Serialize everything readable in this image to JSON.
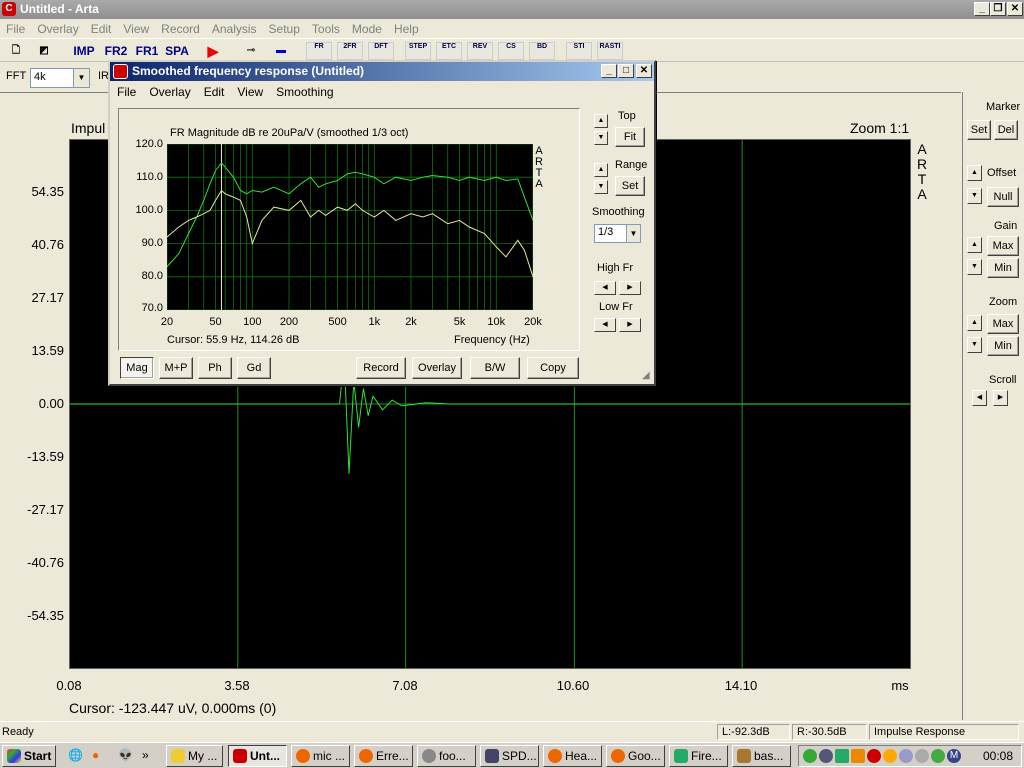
{
  "window": {
    "title": "Untitled - Arta",
    "menu": [
      "File",
      "Overlay",
      "Edit",
      "View",
      "Record",
      "Analysis",
      "Setup",
      "Tools",
      "Mode",
      "Help"
    ]
  },
  "toolbar": {
    "imp": "IMP",
    "fr2": "FR2",
    "fr1": "FR1",
    "spa": "SPA",
    "small_buttons": [
      "FR",
      "2FR",
      "DFT",
      "STEP",
      "ETC",
      "REV",
      "CS",
      "BD",
      "STI",
      "RASTI"
    ]
  },
  "toolbar2": {
    "fft_label": "FFT",
    "fft_value": "4k",
    "ir_label": "IR"
  },
  "impulse": {
    "title": "Impul",
    "zoom_label": "Zoom 1:1",
    "arta_vertical": [
      "A",
      "R",
      "T",
      "A"
    ],
    "y_ticks": [
      "54.35",
      "40.76",
      "27.17",
      "13.59",
      "0.00",
      "-13.59",
      "-27.17",
      "-40.76",
      "-54.35"
    ],
    "x_ticks": [
      "0.08",
      "3.58",
      "7.08",
      "10.60",
      "14.10"
    ],
    "x_unit": "ms",
    "cursor": "Cursor: -123.447 uV, 0.000ms (0)"
  },
  "right_panel": {
    "marker_label": "Marker",
    "marker_set": "Set",
    "marker_del": "Del",
    "offset_label": "Offset",
    "offset_null": "Null",
    "gain_label": "Gain",
    "gain_max": "Max",
    "gain_min": "Min",
    "zoom_label": "Zoom",
    "zoom_max": "Max",
    "zoom_min": "Min",
    "scroll_label": "Scroll"
  },
  "dialog": {
    "title": "Smoothed frequency response (Untitled)",
    "menu": [
      "File",
      "Overlay",
      "Edit",
      "View",
      "Smoothing"
    ],
    "top_label": "Top",
    "fit": "Fit",
    "range_label": "Range",
    "set": "Set",
    "smoothing_label": "Smoothing",
    "smoothing_value": "1/3",
    "high_fr_label": "High Fr",
    "low_fr_label": "Low Fr",
    "bottom_buttons": [
      "Mag",
      "M+P",
      "Ph",
      "Gd"
    ],
    "action_buttons": [
      "Record",
      "Overlay",
      "B/W",
      "Copy"
    ]
  },
  "chart_data": {
    "type": "line",
    "title": "FR Magnitude dB re 20uPa/V (smoothed 1/3 oct)",
    "xlabel": "Frequency (Hz)",
    "ylabel": "",
    "x_scale": "log",
    "xlim": [
      20,
      20000
    ],
    "ylim": [
      70,
      120
    ],
    "x_tick_labels": [
      "20",
      "50",
      "100",
      "200",
      "500",
      "1k",
      "2k",
      "5k",
      "10k",
      "20k"
    ],
    "y_tick_labels": [
      "120.0",
      "110.0",
      "100.0",
      "90.0",
      "80.0",
      "70.0"
    ],
    "arta_vertical": [
      "A",
      "R",
      "T",
      "A"
    ],
    "cursor": "Cursor: 55.9 Hz, 114.26 dB",
    "cursor_x": 55.9,
    "grid": true,
    "series": [
      {
        "color": "#33e033",
        "x": [
          20,
          25,
          30,
          35,
          40,
          45,
          50,
          55.9,
          60,
          70,
          80,
          90,
          100,
          120,
          150,
          200,
          250,
          300,
          350,
          400,
          500,
          600,
          700,
          800,
          1000,
          1200,
          1500,
          2000,
          2500,
          3000,
          4000,
          5000,
          6000,
          8000,
          10000,
          12000,
          15000,
          17000,
          20000
        ],
        "y": [
          83,
          87,
          93,
          98,
          103,
          108,
          112,
          114.3,
          113,
          110,
          106,
          105,
          106,
          105.5,
          107,
          105,
          108,
          110,
          107,
          108,
          109,
          111,
          111.5,
          111,
          110,
          108,
          110,
          109,
          110,
          110.5,
          110,
          109,
          110,
          109,
          110,
          109,
          109.5,
          104,
          97
        ]
      },
      {
        "color": "#e6e69a",
        "x": [
          20,
          25,
          30,
          35,
          40,
          45,
          50,
          55.9,
          60,
          70,
          80,
          90,
          100,
          120,
          150,
          200,
          250,
          300,
          350,
          400,
          500,
          600,
          700,
          800,
          1000,
          1200,
          1500,
          2000,
          2500,
          3000,
          4000,
          5000,
          6000,
          8000,
          10000,
          12000,
          15000,
          17000,
          20000
        ],
        "y": [
          92,
          95,
          97,
          98,
          99,
          100,
          103,
          106,
          105,
          104,
          103,
          98,
          90,
          97,
          101,
          100,
          103,
          98,
          100,
          98.5,
          101,
          100,
          102,
          100,
          98,
          100,
          97,
          99,
          98,
          99,
          96,
          97,
          95,
          93,
          89,
          86,
          91,
          88,
          80
        ]
      }
    ]
  },
  "impulse_data": {
    "type": "line",
    "xlim": [
      0.08,
      17.6
    ],
    "ylim": [
      -67.94,
      67.94
    ],
    "series": [
      {
        "color": "#33e033",
        "x": [
          0.08,
          5.7,
          5.8,
          5.9,
          6.0,
          6.1,
          6.2,
          6.3,
          6.4,
          6.6,
          6.8,
          7.0,
          7.5,
          8.0,
          17.6
        ],
        "y": [
          0,
          0,
          12,
          -18,
          6,
          -6,
          4,
          -3,
          2,
          -1.5,
          1,
          -0.5,
          0.3,
          0,
          0
        ]
      }
    ]
  },
  "statusbar": {
    "ready": "Ready",
    "left_level": "L:-92.3dB",
    "right_level": "R:-30.5dB",
    "mode": "Impulse Response"
  },
  "taskbar": {
    "start": "Start",
    "tasks": [
      "My ...",
      "Unt...",
      "mic ...",
      "Erre...",
      "foo...",
      "SPD...",
      "Hea...",
      "Goo...",
      "Fire...",
      "bas..."
    ],
    "clock": "00:08"
  }
}
